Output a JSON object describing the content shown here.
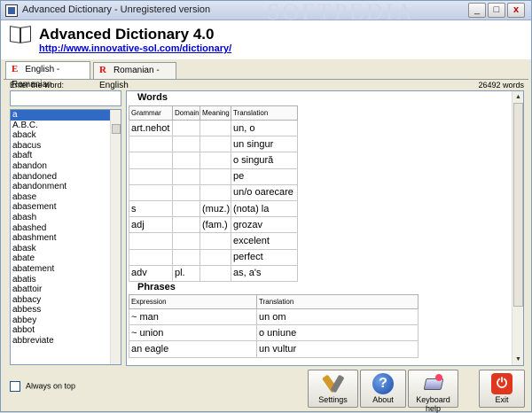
{
  "window": {
    "title": "Advanced Dictionary - Unregistered version",
    "watermark": "SOFTPEDIA",
    "min_label": "_",
    "max_label": "□",
    "close_label": "x"
  },
  "header": {
    "app_name": "Advanced Dictionary 4.0",
    "url": "http://www.innovative-sol.com/dictionary/"
  },
  "tabs": [
    {
      "letter": "E",
      "label": "English - Romanian"
    },
    {
      "letter": "R",
      "label": "Romanian - English"
    }
  ],
  "search": {
    "label": "Enter the word:",
    "value": "",
    "count": "26492 words"
  },
  "wordlist": [
    "a",
    "A.B.C.",
    "aback",
    "abacus",
    "abaft",
    "abandon",
    "abandoned",
    "abandonment",
    "abase",
    "abasement",
    "abash",
    "abashed",
    "abashment",
    "abask",
    "abate",
    "abatement",
    "abatis",
    "abattoir",
    "abbacy",
    "abbess",
    "abbey",
    "abbot",
    "abbreviate"
  ],
  "words": {
    "title": "Words",
    "headers": [
      "Grammar",
      "Domain",
      "Meaning",
      "Translation"
    ],
    "rows": [
      [
        "art.nehot",
        "",
        "",
        "un, o"
      ],
      [
        "",
        "",
        "",
        "un singur"
      ],
      [
        "",
        "",
        "",
        "o singură"
      ],
      [
        "",
        "",
        "",
        "pe"
      ],
      [
        "",
        "",
        "",
        "un/o oarecare"
      ],
      [
        "s",
        "",
        "(muz.)",
        "(nota) la"
      ],
      [
        "adj",
        "",
        "(fam.)",
        "grozav"
      ],
      [
        "",
        "",
        "",
        "excelent"
      ],
      [
        "",
        "",
        "",
        "perfect"
      ],
      [
        "adv",
        "pl.",
        "",
        "as, a's"
      ]
    ]
  },
  "phrases": {
    "title": "Phrases",
    "headers": [
      "Expression",
      "Translation"
    ],
    "rows": [
      [
        "~ man",
        "un om"
      ],
      [
        "~ union",
        "o uniune"
      ],
      [
        "an eagle",
        "un vultur"
      ]
    ]
  },
  "bottom": {
    "always_on_top": "Always on top",
    "settings": "Settings",
    "about": "About",
    "keyboard_help": "Keyboard help",
    "exit": "Exit",
    "help_glyph": "?",
    "exit_glyph": "⏻"
  }
}
